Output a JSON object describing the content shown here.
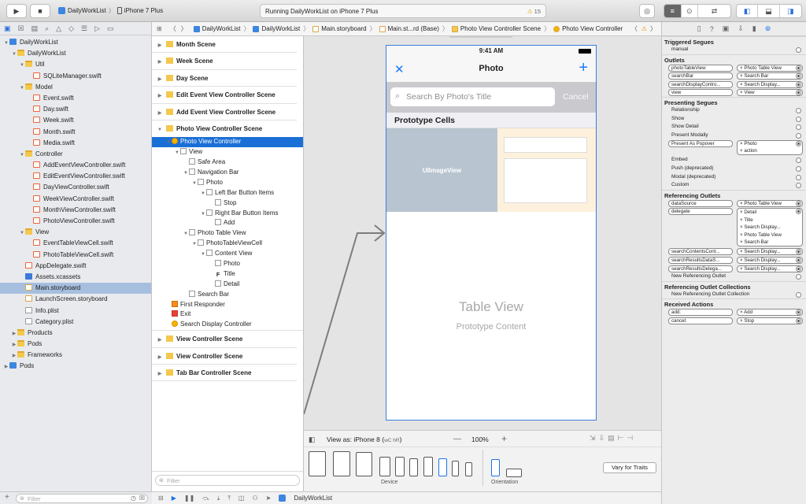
{
  "toolbar": {
    "scheme": "DailyWorkList",
    "device": "iPhone 7 Plus",
    "status": "Running DailyWorkList on iPhone 7 Plus",
    "warning_count": "15"
  },
  "jumpbar": [
    "DailyWorkList",
    "DailyWorkList",
    "Main.storyboard",
    "Main.st...rd (Base)",
    "Photo View Controller Scene",
    "Photo View Controller"
  ],
  "navigator": {
    "filter_placeholder": "Filter",
    "items": [
      {
        "label": "DailyWorkList",
        "icon": "proj",
        "depth": 0,
        "tri": "▼"
      },
      {
        "label": "DailyWorkList",
        "icon": "folder",
        "depth": 1,
        "tri": "▼"
      },
      {
        "label": "Util",
        "icon": "folder",
        "depth": 2,
        "tri": "▼"
      },
      {
        "label": "SQLiteManager.swift",
        "icon": "swift",
        "depth": 3,
        "tri": ""
      },
      {
        "label": "Model",
        "icon": "folder",
        "depth": 2,
        "tri": "▼"
      },
      {
        "label": "Event.swift",
        "icon": "swift",
        "depth": 3,
        "tri": ""
      },
      {
        "label": "Day.swift",
        "icon": "swift",
        "depth": 3,
        "tri": ""
      },
      {
        "label": "Week.swift",
        "icon": "swift",
        "depth": 3,
        "tri": ""
      },
      {
        "label": "Month.swift",
        "icon": "swift",
        "depth": 3,
        "tri": ""
      },
      {
        "label": "Media.swift",
        "icon": "swift",
        "depth": 3,
        "tri": ""
      },
      {
        "label": "Controller",
        "icon": "folder",
        "depth": 2,
        "tri": "▼"
      },
      {
        "label": "AddEventViewController.swift",
        "icon": "swift",
        "depth": 3,
        "tri": ""
      },
      {
        "label": "EditEventViewController.swift",
        "icon": "swift",
        "depth": 3,
        "tri": ""
      },
      {
        "label": "DayViewController.swift",
        "icon": "swift",
        "depth": 3,
        "tri": ""
      },
      {
        "label": "WeekViewController.swift",
        "icon": "swift",
        "depth": 3,
        "tri": ""
      },
      {
        "label": "MonthViewController.swift",
        "icon": "swift",
        "depth": 3,
        "tri": ""
      },
      {
        "label": "PhotoViewController.swift",
        "icon": "swift",
        "depth": 3,
        "tri": ""
      },
      {
        "label": "View",
        "icon": "folder",
        "depth": 2,
        "tri": "▼"
      },
      {
        "label": "EventTableViewCell.swift",
        "icon": "swift",
        "depth": 3,
        "tri": ""
      },
      {
        "label": "PhotoTableViewCell.swift",
        "icon": "swift",
        "depth": 3,
        "tri": ""
      },
      {
        "label": "AppDelegate.swift",
        "icon": "swift",
        "depth": 2,
        "tri": ""
      },
      {
        "label": "Assets.xcassets",
        "icon": "xc",
        "depth": 2,
        "tri": ""
      },
      {
        "label": "Main.storyboard",
        "icon": "sb",
        "depth": 2,
        "tri": "",
        "sel": true
      },
      {
        "label": "LaunchScreen.storyboard",
        "icon": "sb",
        "depth": 2,
        "tri": ""
      },
      {
        "label": "Info.plist",
        "icon": "pl",
        "depth": 2,
        "tri": ""
      },
      {
        "label": "Category.plist",
        "icon": "pl",
        "depth": 2,
        "tri": ""
      },
      {
        "label": "Products",
        "icon": "folder",
        "depth": 1,
        "tri": "▶"
      },
      {
        "label": "Pods",
        "icon": "folder",
        "depth": 1,
        "tri": "▶"
      },
      {
        "label": "Frameworks",
        "icon": "folder",
        "depth": 1,
        "tri": "▶"
      },
      {
        "label": "Pods",
        "icon": "proj",
        "depth": 0,
        "tri": "▶"
      }
    ]
  },
  "outline": {
    "filter_placeholder": "Filter",
    "scenes_top": [
      "Month Scene",
      "Week Scene",
      "Day Scene",
      "Edit Event View Controller Scene",
      "Add Event View Controller Scene",
      "Photo View Controller Scene"
    ],
    "rows": [
      {
        "label": "Photo View Controller",
        "depth": 1,
        "tri": "▼",
        "icon": "y",
        "sel": true
      },
      {
        "label": "View",
        "depth": 2,
        "tri": "▼",
        "icon": ""
      },
      {
        "label": "Safe Area",
        "depth": 3,
        "tri": "",
        "icon": ""
      },
      {
        "label": "Navigation Bar",
        "depth": 3,
        "tri": "▼",
        "icon": ""
      },
      {
        "label": "Photo",
        "depth": 4,
        "tri": "▼",
        "icon": ""
      },
      {
        "label": "Left Bar Button Items",
        "depth": 5,
        "tri": "▼",
        "icon": ""
      },
      {
        "label": "Stop",
        "depth": 6,
        "tri": "",
        "icon": ""
      },
      {
        "label": "Right Bar Button Items",
        "depth": 5,
        "tri": "▼",
        "icon": ""
      },
      {
        "label": "Add",
        "depth": 6,
        "tri": "",
        "icon": ""
      },
      {
        "label": "Photo Table View",
        "depth": 3,
        "tri": "▼",
        "icon": ""
      },
      {
        "label": "PhotoTableViewCell",
        "depth": 4,
        "tri": "▼",
        "icon": ""
      },
      {
        "label": "Content View",
        "depth": 5,
        "tri": "▼",
        "icon": ""
      },
      {
        "label": "Photo",
        "depth": 6,
        "tri": "",
        "icon": ""
      },
      {
        "label": "Title",
        "depth": 6,
        "tri": "",
        "icon": "F"
      },
      {
        "label": "Detail",
        "depth": 6,
        "tri": "",
        "icon": ""
      },
      {
        "label": "Search Bar",
        "depth": 3,
        "tri": "",
        "icon": ""
      },
      {
        "label": "First Responder",
        "depth": 1,
        "tri": "",
        "icon": "o"
      },
      {
        "label": "Exit",
        "depth": 1,
        "tri": "",
        "icon": "r"
      },
      {
        "label": "Search Display Controller",
        "depth": 1,
        "tri": "",
        "icon": "y"
      }
    ],
    "scenes_bottom": [
      "View Controller Scene",
      "View Controller Scene",
      "Tab Bar Controller Scene"
    ]
  },
  "phone": {
    "time": "9:41 AM",
    "nav_title": "Photo",
    "close_glyph": "✕",
    "add_glyph": "+",
    "search_placeholder": "Search By Photo's Title",
    "cancel": "Cancel",
    "prototype_cells": "Prototype Cells",
    "image_view": "UIImageView",
    "table_view": "Table View",
    "prototype_content": "Prototype Content"
  },
  "bottom": {
    "view_as": "View as: iPhone 8 (",
    "view_as_keys": "wC hR",
    "view_as_end": ")",
    "minus": "—",
    "zoom": "100%",
    "plus": "+",
    "device_label": "Device",
    "orientation_label": "Orientation",
    "vary": "Vary for Traits"
  },
  "inspector": {
    "triggered_segues": "Triggered Segues",
    "manual": "manual",
    "outlets": "Outlets",
    "outlet_rows": [
      {
        "name": "photoTableView",
        "target": "Photo Table View"
      },
      {
        "name": "searchBar",
        "target": "Search Bar"
      },
      {
        "name": "searchDisplayContro...",
        "target": "Search Display..."
      },
      {
        "name": "view",
        "target": "View"
      }
    ],
    "presenting_segues": "Presenting Segues",
    "segue_rows": [
      "Relationship",
      "Show",
      "Show Detail",
      "Present Modally"
    ],
    "popover": {
      "name": "Present As Popover",
      "target1": "Photo",
      "target2": "action"
    },
    "segue_rows2": [
      "Embed",
      "Push (deprecated)",
      "Modal (deprecated)",
      "Custom"
    ],
    "referencing_outlets": "Referencing Outlets",
    "datasource": {
      "name": "dataSource",
      "target": "Photo Table View"
    },
    "delegate": {
      "name": "delegate",
      "targets": [
        "Detail",
        "Title",
        "Search Display...",
        "Photo Table View",
        "Search Bar"
      ]
    },
    "ref_rows": [
      {
        "name": "searchContentsCont...",
        "target": "Search Display..."
      },
      {
        "name": "searchResultsDataS...",
        "target": "Search Display..."
      },
      {
        "name": "searchResultsDelega...",
        "target": "Search Display..."
      }
    ],
    "new_ref_outlet": "New Referencing Outlet",
    "ref_outlet_collections": "Referencing Outlet Collections",
    "new_ref_collection": "New Referencing Outlet Collection",
    "received_actions": "Received Actions",
    "actions": [
      {
        "name": "add:",
        "target": "Add"
      },
      {
        "name": "cancel:",
        "target": "Stop"
      }
    ]
  },
  "debug_bar": {
    "target": "DailyWorkList"
  }
}
